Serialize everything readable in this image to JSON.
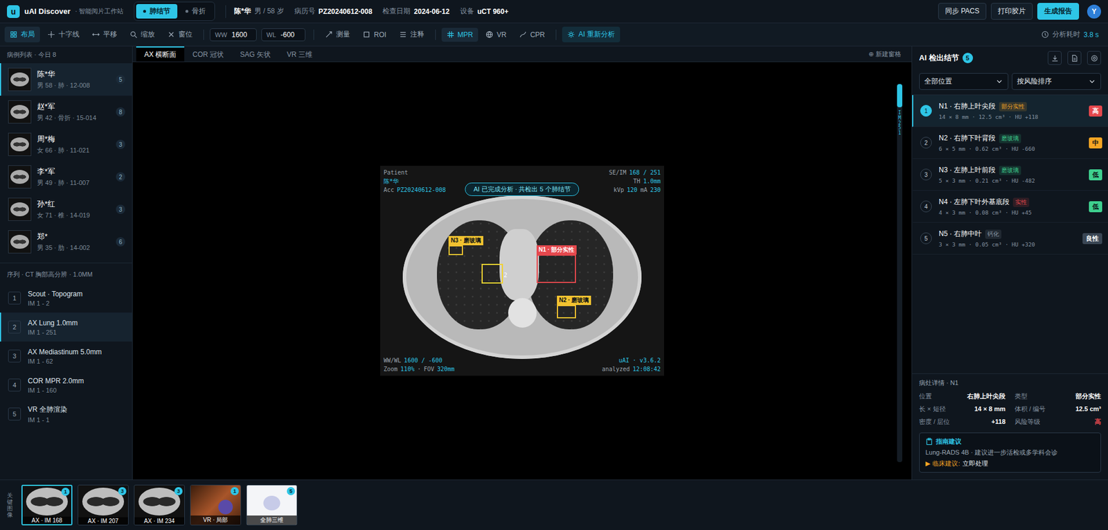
{
  "app": {
    "logo": "u",
    "name": "uAI Discover",
    "subtitle": "· 智能阅片工作站"
  },
  "modes": [
    {
      "label": "肺结节",
      "selected": true
    },
    {
      "label": "骨折",
      "selected": false
    }
  ],
  "patient": {
    "name": "陈*华",
    "info": "男 / 58 岁",
    "fields": [
      {
        "label": "病历号",
        "value": "PZ20240612-008"
      },
      {
        "label": "检查日期",
        "value": "2024-06-12"
      },
      {
        "label": "设备",
        "value": "uCT 960+"
      }
    ]
  },
  "header_buttons": [
    {
      "label": "同步 PACS",
      "primary": false
    },
    {
      "label": "打印胶片",
      "primary": false
    },
    {
      "label": "生成报告",
      "primary": true
    }
  ],
  "avatar": "Y",
  "toolbar": {
    "tools": [
      {
        "label": "布局",
        "kind": "layout",
        "selected": true
      },
      {
        "label": "十字线",
        "kind": "crosshair",
        "selected": false
      },
      {
        "label": "平移",
        "kind": "pan",
        "selected": false
      },
      {
        "label": "缩放",
        "kind": "zoom",
        "selected": false
      },
      {
        "label": "窗位",
        "kind": "reset",
        "selected": false
      }
    ],
    "fields": [
      {
        "label": "WW",
        "value": "1600"
      },
      {
        "label": "WL",
        "value": "-600"
      }
    ],
    "annotate": [
      {
        "label": "测量",
        "kind": "measure",
        "selected": false
      },
      {
        "label": "ROI",
        "kind": "roi",
        "selected": false
      },
      {
        "label": "注释",
        "kind": "notes",
        "selected": false
      }
    ],
    "views": [
      {
        "label": "MPR",
        "kind": "mpr",
        "selected": true
      },
      {
        "label": "VR",
        "kind": "vr",
        "selected": false
      },
      {
        "label": "CPR",
        "kind": "cpr",
        "selected": false
      }
    ],
    "ai_button": "AI 重新分析",
    "timing": {
      "label": "分析耗时",
      "value": "3.8 s"
    }
  },
  "cases_header": "病例列表 · 今日 8",
  "cases": [
    {
      "name": "陈*华",
      "sub": "男 58 · 肺 · 12-008",
      "count": "5",
      "selected": true
    },
    {
      "name": "赵*军",
      "sub": "男 42 · 骨折 · 15-014",
      "count": "8",
      "selected": false
    },
    {
      "name": "周*梅",
      "sub": "女 66 · 肺 · 11-021",
      "count": "3",
      "selected": false
    },
    {
      "name": "李*军",
      "sub": "男 49 · 肺 · 11-007",
      "count": "2",
      "selected": false
    },
    {
      "name": "孙*红",
      "sub": "女 71 · 椎 · 14-019",
      "count": "3",
      "selected": false
    },
    {
      "name": "郑*",
      "sub": "男 35 · 肋 · 14-002",
      "count": "6",
      "selected": false
    }
  ],
  "series_header": "序列 · CT 胸部高分辨 · 1.0MM",
  "series": [
    {
      "num": "1",
      "name": "Scout · Topogram",
      "range": "IM 1 - 2",
      "selected": false
    },
    {
      "num": "2",
      "name": "AX Lung 1.0mm",
      "range": "IM 1 - 251",
      "selected": true
    },
    {
      "num": "3",
      "name": "AX Mediastinum 5.0mm",
      "range": "IM 1 - 62",
      "selected": false
    },
    {
      "num": "4",
      "name": "COR MPR 2.0mm",
      "range": "IM 1 - 160",
      "selected": false
    },
    {
      "num": "5",
      "name": "VR 全肺渲染",
      "range": "IM 1 - 1",
      "selected": false
    }
  ],
  "view_tabs": [
    {
      "label": "AX 横断面",
      "selected": true
    },
    {
      "label": "COR 冠状",
      "selected": false
    },
    {
      "label": "SAG 矢状",
      "selected": false
    },
    {
      "label": "VR 三维",
      "selected": false
    }
  ],
  "new_pane": "⊕ 新建窗格",
  "viewer": {
    "banner": "AI 已完成分析 · 共检出 5 个肺结节",
    "top_left": [
      [
        {
          "t": "Patient",
          "hl": false
        }
      ],
      [
        {
          "t": "陈*华",
          "hl": true
        }
      ],
      [
        {
          "t": "Acc",
          "hl": false
        },
        {
          "t": "PZ20240612-008",
          "hl": true
        }
      ]
    ],
    "top_right": [
      [
        {
          "t": "SE/IM",
          "hl": false
        },
        {
          "t": "168 / 251",
          "hl": true
        }
      ],
      [
        {
          "t": "TH",
          "hl": false
        },
        {
          "t": "1.0mm",
          "hl": true
        }
      ],
      [
        {
          "t": "kVp",
          "hl": false
        },
        {
          "t": "120",
          "hl": true
        },
        {
          "t": "mA",
          "hl": false
        },
        {
          "t": "230",
          "hl": true
        }
      ]
    ],
    "bottom_left": [
      [
        {
          "t": "WW/WL",
          "hl": false
        },
        {
          "t": "1600 / -600",
          "hl": true
        }
      ],
      [
        {
          "t": "Zoom",
          "hl": false
        },
        {
          "t": "110%",
          "hl": true
        },
        {
          "t": "·",
          "hl": false
        },
        {
          "t": "FOV",
          "hl": false
        },
        {
          "t": "320mm",
          "hl": true
        }
      ]
    ],
    "bottom_right": [
      [
        {
          "t": "uAI · v3.6.2",
          "hl": true
        }
      ],
      [
        {
          "t": "analyzed",
          "hl": false
        },
        {
          "t": "12:08:42",
          "hl": true
        }
      ]
    ],
    "markers": [
      {
        "label": "N3 · 磨玻璃",
        "kind": "tag",
        "color": "#f2c230"
      },
      {
        "label": "2",
        "kind": "side",
        "color": "#f2d230"
      },
      {
        "label": "N1 · 部分实性",
        "kind": "tag",
        "color": "#e5484d"
      },
      {
        "label": "N2 · 磨玻璃",
        "kind": "tag",
        "color": "#f2c230"
      }
    ],
    "slice_label": "IM 251",
    "slice_level": 0.06
  },
  "panel": {
    "title": "AI 检出结节",
    "count": "5",
    "filters": [
      {
        "label": "全部位置"
      },
      {
        "label": "按风险排序"
      }
    ]
  },
  "nodules": [
    {
      "num": "1",
      "title": "N1 · 右肺上叶尖段",
      "tag": {
        "label": "部分实性",
        "color": "#f5a524"
      },
      "meta": "14 × 8 mm · 12.5 cm³ · HU +118",
      "risk": {
        "label": "高",
        "color": "#e5484d"
      },
      "selected": true
    },
    {
      "num": "2",
      "title": "N2 · 右肺下叶背段",
      "tag": {
        "label": "磨玻璃",
        "color": "#3ecf8e"
      },
      "meta": "6 × 5 mm · 0.62 cm³ · HU -660",
      "risk": {
        "label": "中",
        "color": "#f5a524"
      },
      "selected": false
    },
    {
      "num": "3",
      "title": "N3 · 左肺上叶前段",
      "tag": {
        "label": "磨玻璃",
        "color": "#3ecf8e"
      },
      "meta": "5 × 3 mm · 0.21 cm³ · HU -482",
      "risk": {
        "label": "低",
        "color": "#3ecf8e"
      },
      "selected": false
    },
    {
      "num": "4",
      "title": "N4 · 左肺下叶外基底段",
      "tag": {
        "label": "实性",
        "color": "#e5484d"
      },
      "meta": "4 × 3 mm · 0.08 cm³ · HU +45",
      "risk": {
        "label": "低",
        "color": "#3ecf8e"
      },
      "selected": false
    },
    {
      "num": "5",
      "title": "N5 · 右肺中叶",
      "tag": {
        "label": "钙化",
        "color": "#8b98a6"
      },
      "meta": "3 × 3 mm · 0.05 cm³ · HU +320",
      "risk": {
        "label": "良性",
        "color": "#3a4654"
      },
      "selected": false
    }
  ],
  "details": {
    "title": "病灶详情 · N1",
    "items": [
      {
        "label": "位置",
        "value": "右肺上叶尖段",
        "danger": false
      },
      {
        "label": "类型",
        "value": "部分实性",
        "danger": false
      },
      {
        "label": "长 × 短径",
        "value": "14 × 8 mm",
        "danger": false
      },
      {
        "label": "体积 / 编号",
        "value": "12.5 cm³",
        "danger": false
      },
      {
        "label": "密度 / 层位",
        "value": "+118",
        "danger": false
      },
      {
        "label": "风险等级",
        "value": "高",
        "danger": true
      }
    ]
  },
  "guideline": {
    "title": "指南建议",
    "text": "Lung-RADS 4B · 建议进一步活检或多学科会诊",
    "marker": "▶",
    "action_label": "临床建议:",
    "action_value": "立即处理"
  },
  "strip": {
    "label": "关键图像",
    "items": [
      {
        "label": "AX · IM 168",
        "count": "1",
        "kind": "ct",
        "selected": true
      },
      {
        "label": "AX · IM 207",
        "count": "3",
        "kind": "ct",
        "selected": false
      },
      {
        "label": "AX · IM 234",
        "count": "3",
        "kind": "ct",
        "selected": false
      },
      {
        "label": "VR · 局部",
        "count": "1",
        "kind": "vr",
        "selected": false
      },
      {
        "label": "全肺三维",
        "count": "5",
        "kind": "doc",
        "selected": false
      }
    ]
  }
}
